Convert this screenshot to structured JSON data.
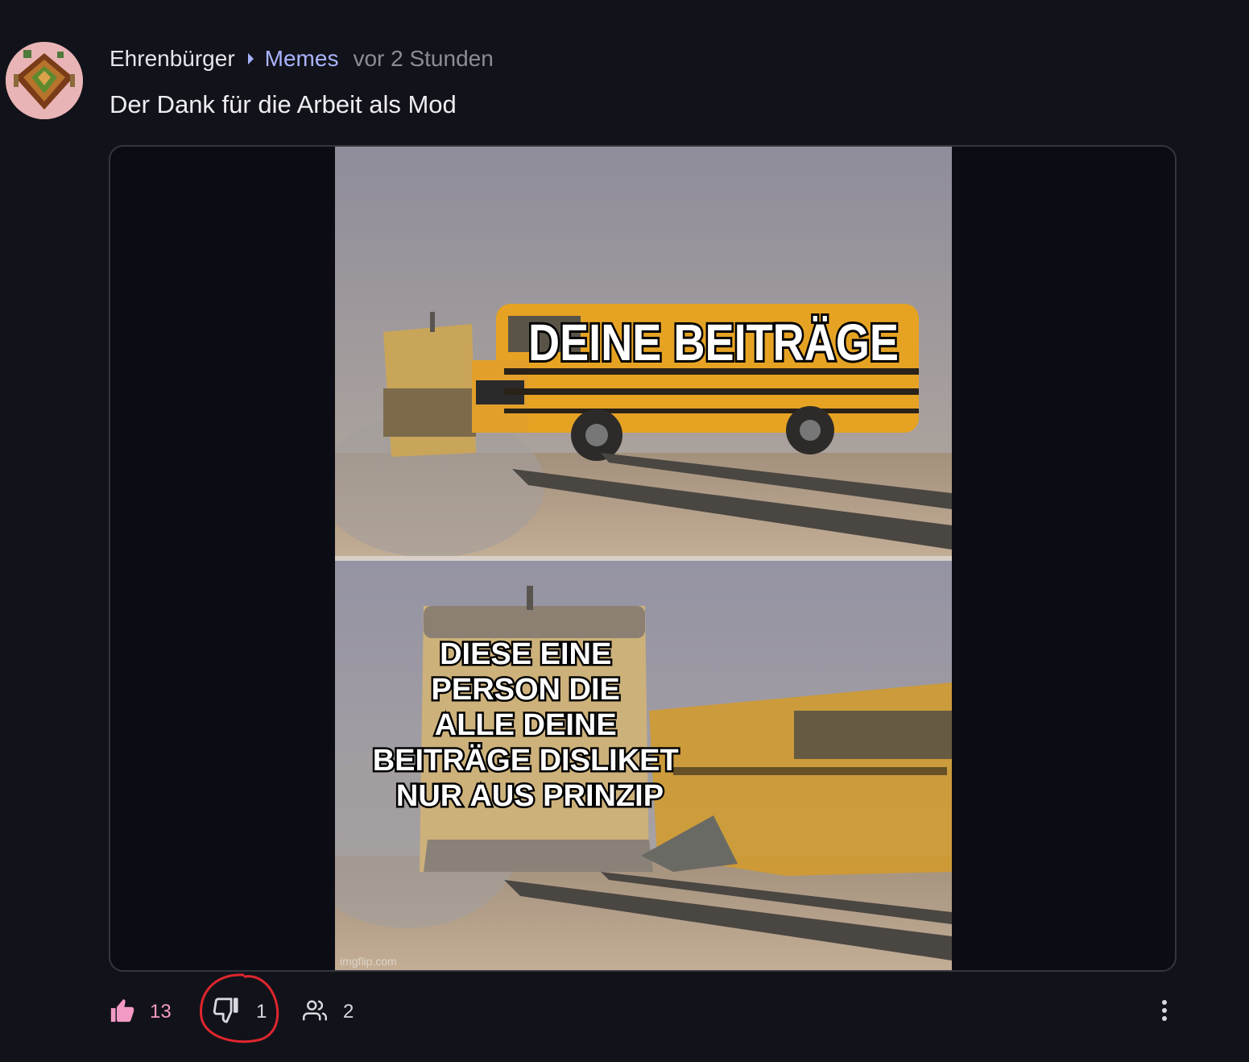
{
  "post": {
    "author": "Ehrenbürger",
    "community": "Memes",
    "time": "vor 2 Stunden",
    "title": "Der Dank für die Arbeit als Mod"
  },
  "meme": {
    "top_caption": "DEINE BEITRÄGE",
    "bottom_caption_lines": [
      "DIESE EINE",
      "PERSON DIE",
      "ALLE DEINE",
      "BEITRÄGE DISLIKET",
      "NUR AUS PRINZIP"
    ],
    "watermark": "imgflip.com"
  },
  "actions": {
    "upvotes": "13",
    "downvotes": "1",
    "crossposts": "2"
  },
  "icons": {
    "upvote": "thumbs-up-icon",
    "downvote": "thumbs-down-icon",
    "crosspost": "users-icon",
    "more": "more-vertical-icon"
  },
  "colors": {
    "background": "#12131a",
    "community_link": "#aab4ff",
    "upvote_accent": "#f39ac4",
    "annotation_circle": "#e0262e"
  }
}
